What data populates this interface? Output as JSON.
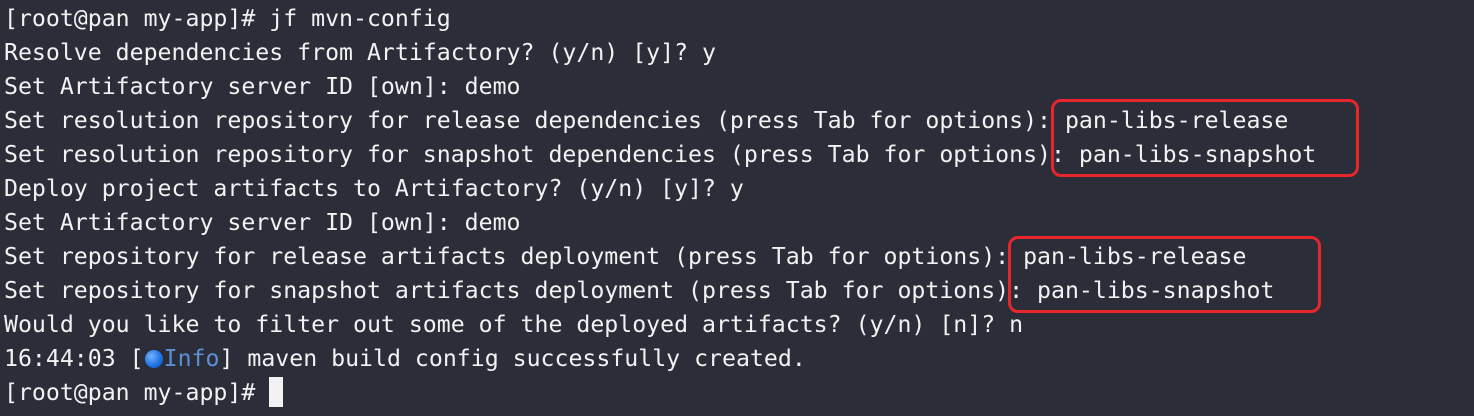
{
  "terminal": {
    "lines": [
      "[root@pan my-app]# jf mvn-config",
      "Resolve dependencies from Artifactory? (y/n) [y]? y",
      "Set Artifactory server ID [own]: demo",
      "Set resolution repository for release dependencies (press Tab for options): pan-libs-release",
      "Set resolution repository for snapshot dependencies (press Tab for options): pan-libs-snapshot",
      "Deploy project artifacts to Artifactory? (y/n) [y]? y",
      "Set Artifactory server ID [own]: demo",
      "Set repository for release artifacts deployment (press Tab for options): pan-libs-release",
      "Set repository for snapshot artifacts deployment (press Tab for options): pan-libs-snapshot",
      "Would you like to filter out some of the deployed artifacts? (y/n) [n]? n"
    ],
    "log_line": {
      "timestamp": "16:44:03",
      "open_bracket": " [",
      "level": "Info",
      "close_and_message": "] maven build config successfully created."
    },
    "prompt": "[root@pan my-app]#"
  },
  "colors": {
    "background": "#2b2d39",
    "text": "#f2f2f2",
    "info": "#5d8fd6",
    "highlight": "#e8262b"
  },
  "icons": {
    "info": "blue-circle-icon"
  }
}
